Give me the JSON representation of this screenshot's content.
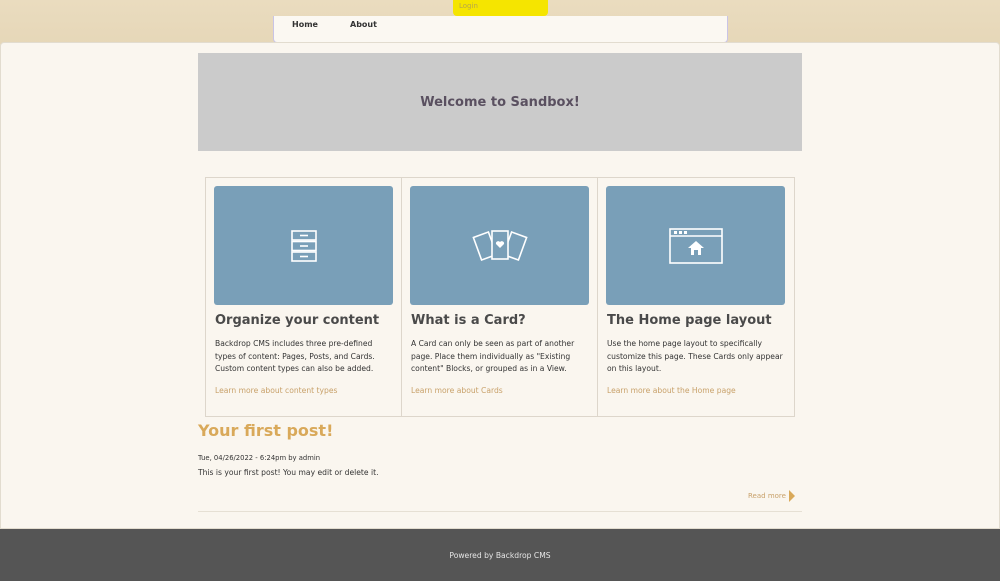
{
  "header": {
    "login_label": "Login",
    "nav": [
      {
        "label": "Home"
      },
      {
        "label": "About"
      }
    ]
  },
  "hero": {
    "title": "Welcome to Sandbox!"
  },
  "cards": [
    {
      "icon": "filing-cabinet-icon",
      "title": "Organize your content",
      "body": "Backdrop CMS includes three pre-defined types of content: Pages, Posts, and Cards. Custom content types can also be added.",
      "link": "Learn more about content types"
    },
    {
      "icon": "cards-icon",
      "title": "What is a Card?",
      "body": "A Card can only be seen as part of another page. Place them individually as \"Existing content\" Blocks, or grouped as in a View.",
      "link": "Learn more about Cards"
    },
    {
      "icon": "home-layout-icon",
      "title": "The Home page layout",
      "body": "Use the home page layout to specifically customize this page. These Cards only appear on this layout.",
      "link": "Learn more about the Home page"
    }
  ],
  "post": {
    "title": "Your first post!",
    "meta": "Tue, 04/26/2022 - 6:24pm by admin",
    "body": "This is your first post! You may edit or delete it.",
    "read_more": "Read more"
  },
  "footer": {
    "text": "Powered by Backdrop CMS"
  },
  "colors": {
    "accent": "#d9a95a",
    "card_image_bg": "#799fb8",
    "footer_bg": "#555555",
    "login_tab_bg": "#f5e500"
  }
}
